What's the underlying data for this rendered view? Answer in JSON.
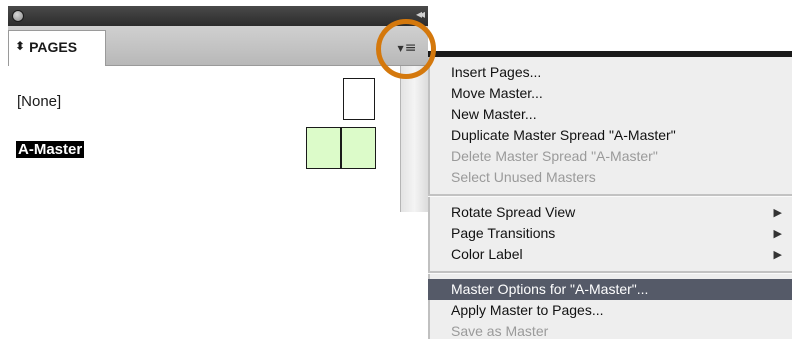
{
  "panel": {
    "tab_label": "PAGES",
    "tab_icon": "updown-arrows-icon",
    "collapse_glyph": "◂◂",
    "menu_button_glyph": "≡",
    "masters": [
      {
        "label": "[None]",
        "thumb": "single",
        "selected": false
      },
      {
        "label": "A-Master",
        "thumb": "spread",
        "selected": true
      }
    ]
  },
  "menu": {
    "items": [
      {
        "label": "Insert Pages...",
        "enabled": true
      },
      {
        "label": "Move Master...",
        "enabled": true
      },
      {
        "label": "New Master...",
        "enabled": true
      },
      {
        "label": "Duplicate Master Spread \"A-Master\"",
        "enabled": true
      },
      {
        "label": "Delete Master Spread \"A-Master\"",
        "enabled": false
      },
      {
        "label": "Select Unused Masters",
        "enabled": false
      },
      {
        "label": "Rotate Spread View",
        "enabled": true,
        "submenu": true
      },
      {
        "label": "Page Transitions",
        "enabled": true,
        "submenu": true
      },
      {
        "label": "Color Label",
        "enabled": true,
        "submenu": true
      },
      {
        "label": "Master Options for \"A-Master\"...",
        "enabled": true,
        "active": true
      },
      {
        "label": "Apply Master to Pages...",
        "enabled": true
      },
      {
        "label": "Save as Master",
        "enabled": false
      }
    ],
    "submenu_glyph": "▶"
  },
  "colors": {
    "highlight_ring": "#d4780c",
    "active_item": "#555a68",
    "spread_fill": "#dcfbc9"
  }
}
